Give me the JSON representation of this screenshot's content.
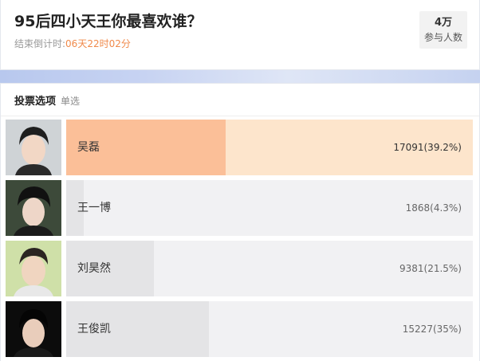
{
  "poll": {
    "title": "95后四小天王你最喜欢谁？",
    "countdown_label": "结束倒计时:",
    "countdown_value": "06天22时02分",
    "participants_value": "4万",
    "participants_label": "参与人数"
  },
  "options_header": {
    "title": "投票选项",
    "mode": "单选"
  },
  "options": [
    {
      "name": "吴磊",
      "result": "17091(39.2%)",
      "share": 0.392
    },
    {
      "name": "王一博",
      "result": "1868(4.3%)",
      "share": 0.043
    },
    {
      "name": "刘昊然",
      "result": "9381(21.5%)",
      "share": 0.215
    },
    {
      "name": "王俊凯",
      "result": "15227(35%)",
      "share": 0.35
    }
  ],
  "colors": {
    "accent": "#f08a4b",
    "leading_fill": "#fbbf98",
    "leading_track": "#fde5cc",
    "fill": "#e4e4e6",
    "track": "#f1f1f3"
  }
}
